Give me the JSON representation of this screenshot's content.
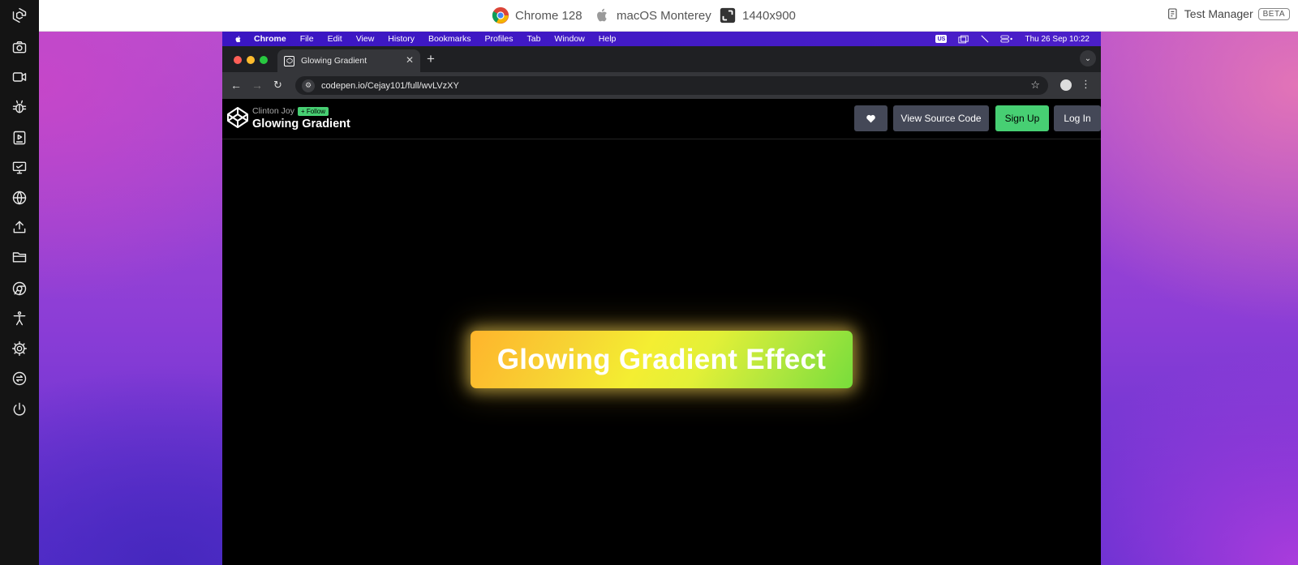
{
  "topbar": {
    "browser": "Chrome 128",
    "os": "macOS Monterey",
    "resolution": "1440x900",
    "test_manager": "Test Manager",
    "beta": "BETA"
  },
  "menubar": {
    "app": "Chrome",
    "items": [
      "File",
      "Edit",
      "View",
      "History",
      "Bookmarks",
      "Profiles",
      "Tab",
      "Window",
      "Help"
    ],
    "input_source": "US",
    "datetime": "Thu 26 Sep  10:22"
  },
  "tab": {
    "title": "Glowing Gradient"
  },
  "omnibox": {
    "url": "codepen.io/Cejay101/full/wvLVzXY"
  },
  "codepen": {
    "author": "Clinton Joy",
    "follow": "+ Follow",
    "title": "Glowing Gradient",
    "buttons": {
      "source": "View Source Code",
      "signup": "Sign Up",
      "login": "Log In"
    }
  },
  "demo": {
    "button_text": "Glowing Gradient Effect"
  },
  "colors": {
    "accent_green": "#47cf73",
    "menubar": "#3a16c2"
  }
}
